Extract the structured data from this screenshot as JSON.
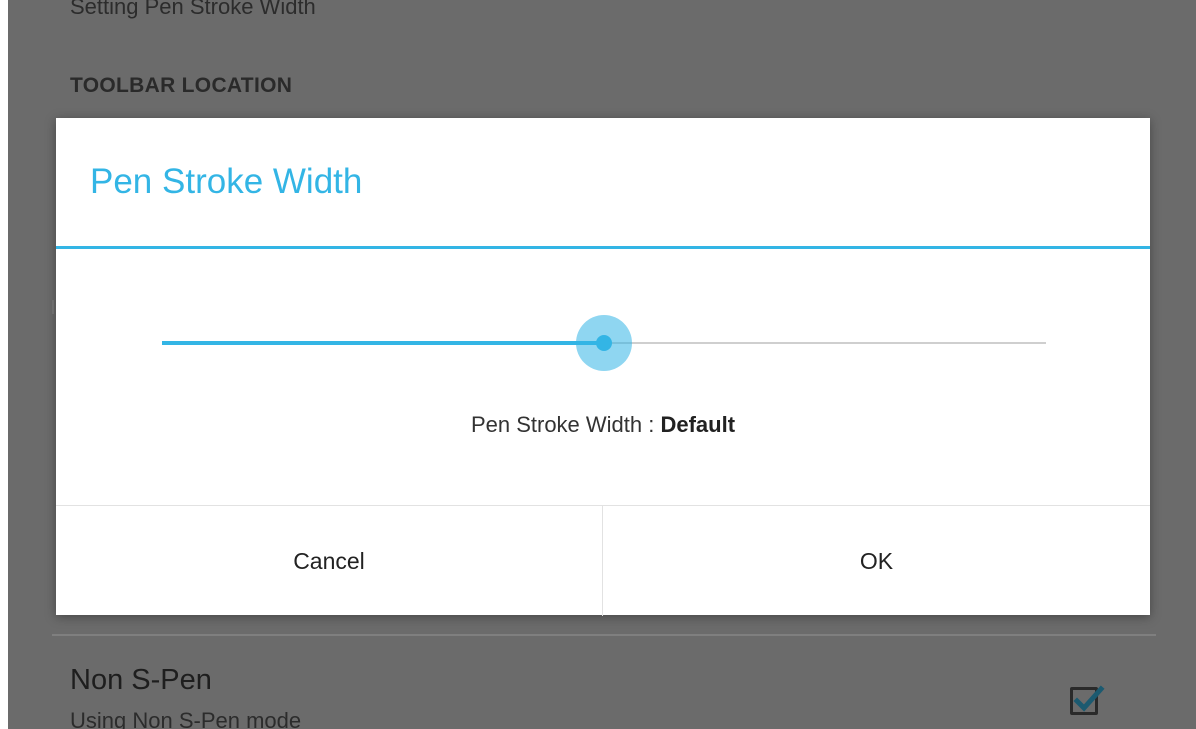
{
  "background": {
    "prev_item_subtitle": "Setting Pen Stroke Width",
    "section_header": "TOOLBAR LOCATION",
    "item_title": "Non S-Pen",
    "item_subtitle": "Using Non S-Pen mode",
    "item_checked": true
  },
  "dialog": {
    "title": "Pen Stroke Width",
    "slider": {
      "value_fraction": 0.5
    },
    "value_label": "Pen Stroke Width : ",
    "value_text": "Default",
    "cancel_label": "Cancel",
    "ok_label": "OK"
  },
  "colors": {
    "accent": "#33b5e5",
    "scrim": "#6b6b6b"
  }
}
